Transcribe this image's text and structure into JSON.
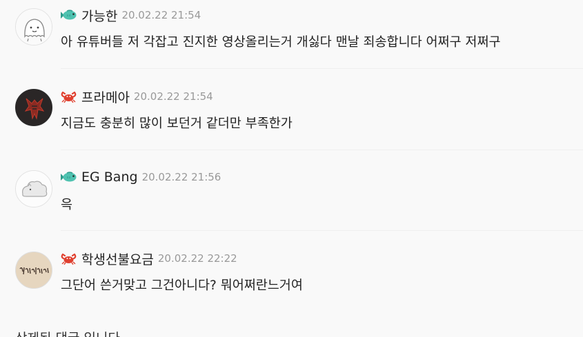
{
  "comments": [
    {
      "nickname": "가능한",
      "time": "20.02.22 21:54",
      "level_icon": "fish-icon",
      "avatar": "white-ghost-avatar",
      "text": "아 유튜버들 저 각잡고 진지한 영상올리는거 개싫다 맨날 죄송합니다 어쩌구 저쩌구"
    },
    {
      "nickname": "프라메아",
      "time": "20.02.22 21:54",
      "level_icon": "crab-icon",
      "avatar": "horde-emblem-avatar",
      "text": "지금도 충분히 많이 보던거 같더만 부족한가"
    },
    {
      "nickname": "EG Bang",
      "time": "20.02.22 21:56",
      "level_icon": "fish-icon",
      "avatar": "cloud-blob-avatar",
      "text": "윽"
    },
    {
      "nickname": "학생선불요금",
      "time": "20.02.22 22:22",
      "level_icon": "crab-icon",
      "avatar": "calligraphy-avatar",
      "text": "그단어 쓴거맞고 그건아니다? 뭐어쩌란느거여"
    }
  ],
  "deleted_notice": "삭제된 댓글 입니다."
}
